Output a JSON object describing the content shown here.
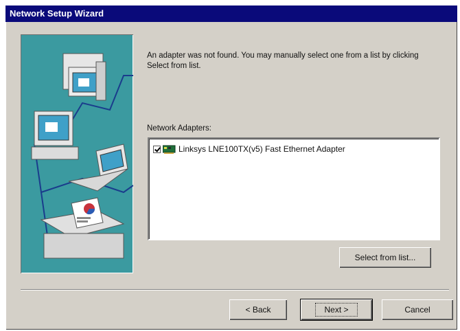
{
  "window": {
    "title": "Network Setup Wizard"
  },
  "instruction": "An adapter was not found. You may manually select one from a list by clicking Select from list.",
  "adapters": {
    "label": "Network Adapters:",
    "items": [
      {
        "checked": true,
        "label": "Linksys LNE100TX(v5) Fast Ethernet Adapter"
      }
    ]
  },
  "buttons": {
    "select_from_list": "Select from list...",
    "back": "< Back",
    "next": "Next >",
    "cancel": "Cancel"
  },
  "colors": {
    "titlebar": "#0a0a7a",
    "dialog_bg": "#d4d0c8",
    "illustration_bg": "#3b9aa0"
  }
}
